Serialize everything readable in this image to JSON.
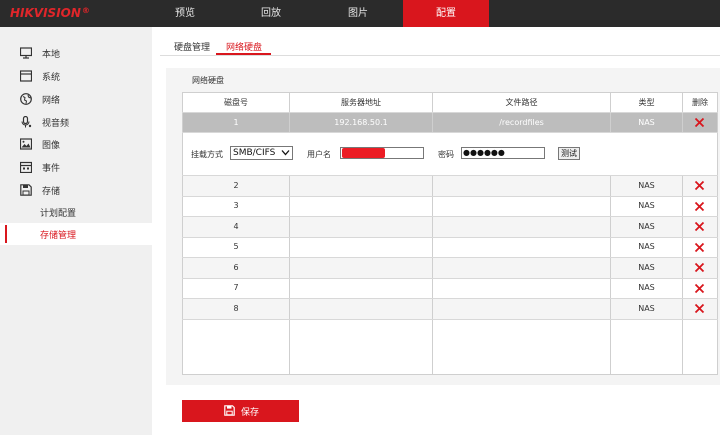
{
  "brand": {
    "name": "HIKVISION",
    "reg": "®"
  },
  "nav": {
    "tabs": [
      {
        "label": "预览"
      },
      {
        "label": "回放"
      },
      {
        "label": "图片"
      },
      {
        "label": "配置",
        "active": true
      }
    ]
  },
  "sidebar": {
    "items": [
      {
        "label": "本地",
        "icon": "monitor-icon"
      },
      {
        "label": "系统",
        "icon": "system-icon"
      },
      {
        "label": "网络",
        "icon": "globe-icon"
      },
      {
        "label": "视音频",
        "icon": "microphone-icon"
      },
      {
        "label": "图像",
        "icon": "image-icon"
      },
      {
        "label": "事件",
        "icon": "calendar-icon"
      },
      {
        "label": "存储",
        "icon": "save-icon"
      }
    ],
    "subitems": [
      {
        "label": "计划配置"
      },
      {
        "label": "存储管理",
        "active": true
      }
    ]
  },
  "subtabs": [
    {
      "label": "硬盘管理"
    },
    {
      "label": "网络硬盘",
      "active": true
    }
  ],
  "panel": {
    "title": "网络硬盘"
  },
  "table": {
    "headers": [
      "磁盘号",
      "服务器地址",
      "文件路径",
      "类型",
      "删除"
    ],
    "rows": [
      {
        "disk": "1",
        "server": "192.168.50.1",
        "path": "/recordfiles",
        "type": "NAS",
        "selected": true
      },
      {
        "disk": "2",
        "server": "",
        "path": "",
        "type": "NAS"
      },
      {
        "disk": "3",
        "server": "",
        "path": "",
        "type": "NAS"
      },
      {
        "disk": "4",
        "server": "",
        "path": "",
        "type": "NAS"
      },
      {
        "disk": "5",
        "server": "",
        "path": "",
        "type": "NAS"
      },
      {
        "disk": "6",
        "server": "",
        "path": "",
        "type": "NAS"
      },
      {
        "disk": "7",
        "server": "",
        "path": "",
        "type": "NAS"
      },
      {
        "disk": "8",
        "server": "",
        "path": "",
        "type": "NAS"
      }
    ]
  },
  "form": {
    "mount_label": "挂载方式",
    "mount_value": "SMB/CIFS",
    "user_label": "用户名",
    "password_label": "密码",
    "password_value": "●●●●●●",
    "test_label": "测试"
  },
  "save": {
    "label": "保存"
  },
  "colors": {
    "accent": "#d9161d",
    "topbar": "#2b2b2b",
    "sidebar": "#f0f0f0"
  }
}
